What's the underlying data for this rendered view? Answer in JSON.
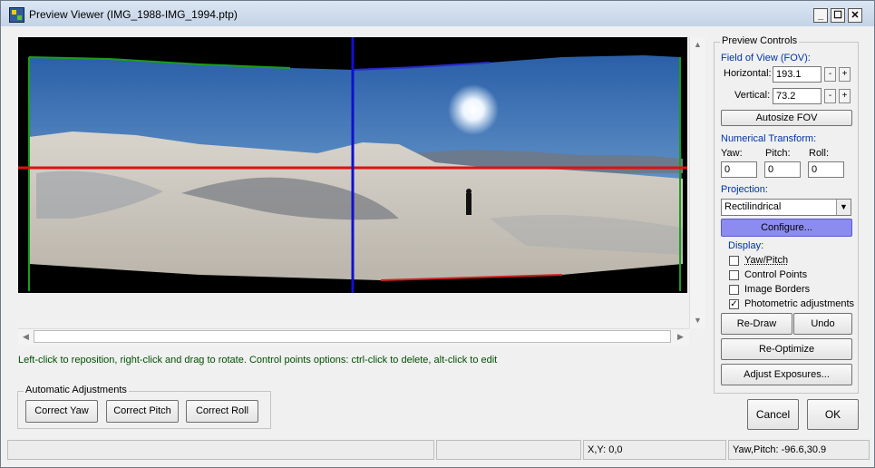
{
  "window": {
    "title": "Preview Viewer (IMG_1988-IMG_1994.ptp)",
    "minimize": "_",
    "maximize": "☐",
    "close": "✕"
  },
  "hint": "Left-click to reposition, right-click and drag to rotate. Control points options: ctrl-click to delete, alt-click to edit",
  "auto": {
    "title": "Automatic Adjustments",
    "yaw": "Correct Yaw",
    "pitch": "Correct Pitch",
    "roll": "Correct Roll"
  },
  "controls": {
    "title": "Preview Controls",
    "fov_label": "Field of View (FOV):",
    "horizontal_label": "Horizontal:",
    "horizontal_value": "193.1",
    "vertical_label": "Vertical:",
    "vertical_value": "73.2",
    "minus": "-",
    "plus": "+",
    "autosize": "Autosize FOV",
    "numerical_label": "Numerical Transform:",
    "yaw_label": "Yaw:",
    "pitch_label": "Pitch:",
    "roll_label": "Roll:",
    "yaw_value": "0",
    "pitch_value": "0",
    "roll_value": "0",
    "projection_label": "Projection:",
    "projection_value": "Rectilindrical",
    "configure": "Configure...",
    "display_label": "Display:",
    "display": [
      {
        "label": "Yaw/Pitch",
        "checked": false
      },
      {
        "label": "Control Points",
        "checked": false
      },
      {
        "label": "Image Borders",
        "checked": false
      },
      {
        "label": "Photometric adjustments",
        "checked": true
      }
    ],
    "redraw": "Re-Draw",
    "undo": "Undo",
    "reoptimize": "Re-Optimize",
    "adjust_exposures": "Adjust Exposures..."
  },
  "buttons": {
    "cancel": "Cancel",
    "ok": "OK"
  },
  "status": {
    "field1": "",
    "field2": "",
    "xy": "X,Y: 0,0",
    "yawpitch": "Yaw,Pitch: -96.6,30.9"
  },
  "colors": {
    "horizon_line": "#e01010",
    "vertical_line": "#1010d0",
    "configure_bg": "#8c8cf0"
  },
  "icons": {
    "scroll_up": "▲",
    "scroll_down": "▼",
    "scroll_left": "◀",
    "scroll_right": "▶",
    "dropdown": "▼",
    "check": "✓"
  }
}
